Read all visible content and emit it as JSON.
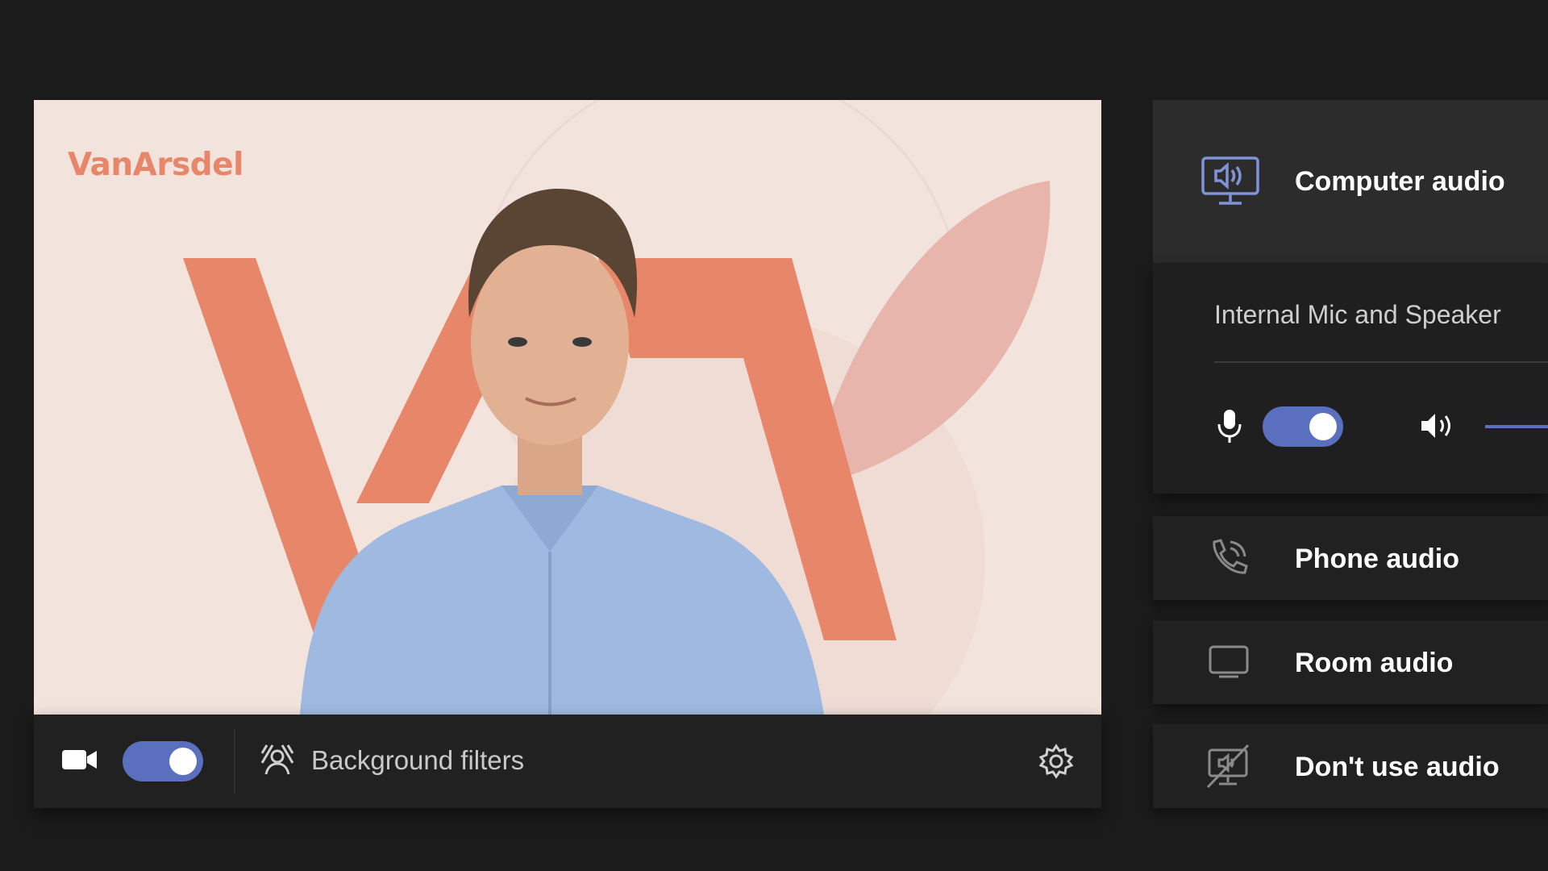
{
  "brand": {
    "name": "VanArsdel",
    "color": "#e8866a"
  },
  "accent_color": "#5b6fbf",
  "preview": {
    "camera_toggle_on": true,
    "background_filters_label": "Background filters"
  },
  "audio": {
    "computer_audio_label": "Computer audio",
    "device_name": "Internal Mic and Speaker",
    "mic_toggle_on": true,
    "options": [
      {
        "label": "Phone audio",
        "icon": "phone-icon"
      },
      {
        "label": "Room audio",
        "icon": "room-device-icon"
      },
      {
        "label": "Don't use audio",
        "icon": "no-audio-icon"
      }
    ]
  }
}
